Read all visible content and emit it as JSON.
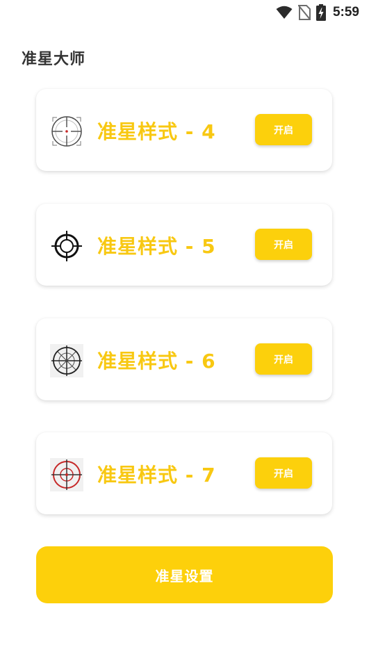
{
  "status_bar": {
    "time": "5:59",
    "icons": [
      "wifi-icon",
      "no-sim-icon",
      "battery-charging-icon"
    ]
  },
  "app": {
    "title": "准星大师"
  },
  "crosshairs": [
    {
      "label": "准星样式 - 4",
      "button": "开启",
      "icon": "crosshair-style-4-icon"
    },
    {
      "label": "准星样式 - 5",
      "button": "开启",
      "icon": "crosshair-style-5-icon"
    },
    {
      "label": "准星样式 - 6",
      "button": "开启",
      "icon": "crosshair-style-6-icon"
    },
    {
      "label": "准星样式 - 7",
      "button": "开启",
      "icon": "crosshair-style-7-icon"
    }
  ],
  "settings_button": {
    "label": "准星设置"
  },
  "colors": {
    "accent": "#fcd00c",
    "label": "#f8c812",
    "crosshair_red": "#c62828"
  }
}
